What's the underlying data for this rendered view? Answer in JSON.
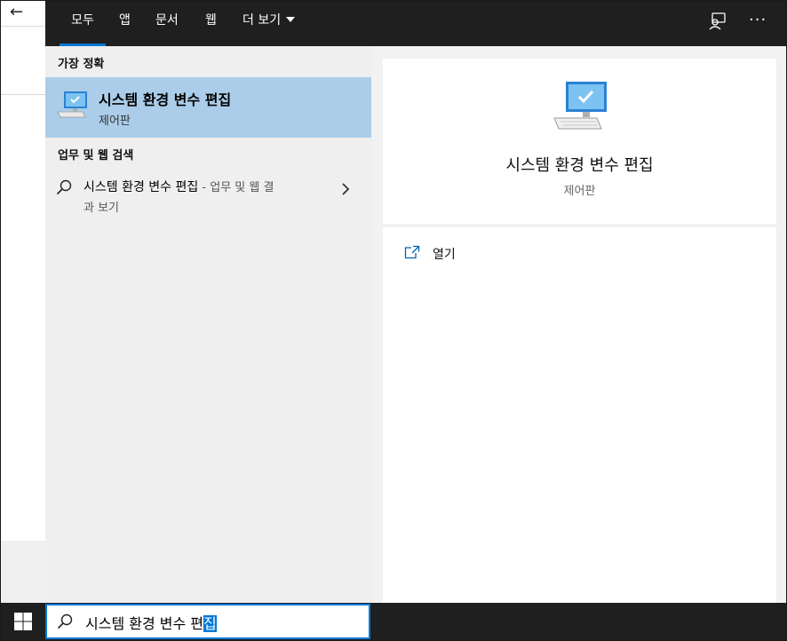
{
  "tabs": [
    {
      "label": "모두",
      "active": true
    },
    {
      "label": "앱"
    },
    {
      "label": "문서"
    },
    {
      "label": "웹"
    },
    {
      "label": "더 보기"
    }
  ],
  "top_icons": [
    "feedback-icon",
    "more-icon"
  ],
  "more_icon_glyph": "···",
  "back_arrow": "←",
  "best_match": {
    "section_label": "가장 정확",
    "title": "시스템 환경 변수 편집",
    "subtitle": "제어판",
    "icon": "computer-monitor-icon"
  },
  "web_search": {
    "section_label": "업무 및 웹 검색",
    "title": "시스템 환경 변수 편집",
    "suffix_line1": " - 업무 및 웹 결",
    "suffix_line2": "과 보기",
    "icon": "search-icon"
  },
  "detail": {
    "title": "시스템 환경 변수 편집",
    "subtitle": "제어판",
    "actions": [
      {
        "label": "열기",
        "icon": "open-icon"
      }
    ]
  },
  "search_box": {
    "query_prefix": "시스템 환경 변수 편",
    "query_selected": "집"
  },
  "colors": {
    "accent": "#0078d7",
    "topbar": "#1f1f1f",
    "best_match_highlight": "#abcde9",
    "panel_bg": "#f2f2f2"
  }
}
